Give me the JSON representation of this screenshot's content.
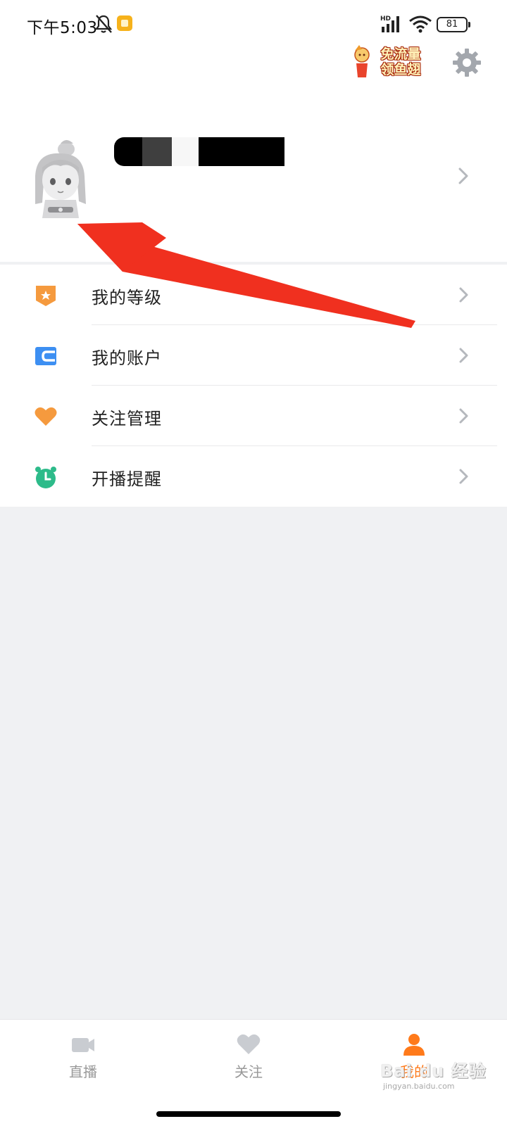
{
  "status_bar": {
    "time": "下午5:03",
    "network_badge": "HD",
    "battery_level": "81"
  },
  "header": {
    "promo_badge_text": "免流量\n领鱼翅",
    "settings_icon": "gear-icon"
  },
  "profile": {
    "avatar_icon": "default-avatar-icon",
    "username_redacted": true
  },
  "menu": {
    "items": [
      {
        "label": "我的等级",
        "icon": "level-badge-icon",
        "color": "#f59a3e"
      },
      {
        "label": "我的账户",
        "icon": "wallet-icon",
        "color": "#3d8ff2"
      },
      {
        "label": "关注管理",
        "icon": "heart-icon",
        "color": "#f59a3e"
      },
      {
        "label": "开播提醒",
        "icon": "alarm-clock-icon",
        "color": "#2dbb8a"
      }
    ]
  },
  "tabbar": {
    "tabs": [
      {
        "label": "直播",
        "icon": "video-camera-icon",
        "active": false
      },
      {
        "label": "关注",
        "icon": "heart-icon",
        "active": false
      },
      {
        "label": "我的",
        "icon": "user-icon",
        "active": true
      }
    ]
  },
  "watermark": {
    "text": "Bai du 经验",
    "sub": "jingyan.baidu.com"
  },
  "colors": {
    "accent": "#ff7a1a",
    "annotation_arrow": "#f0301f",
    "page_bg": "#f0f1f3"
  }
}
